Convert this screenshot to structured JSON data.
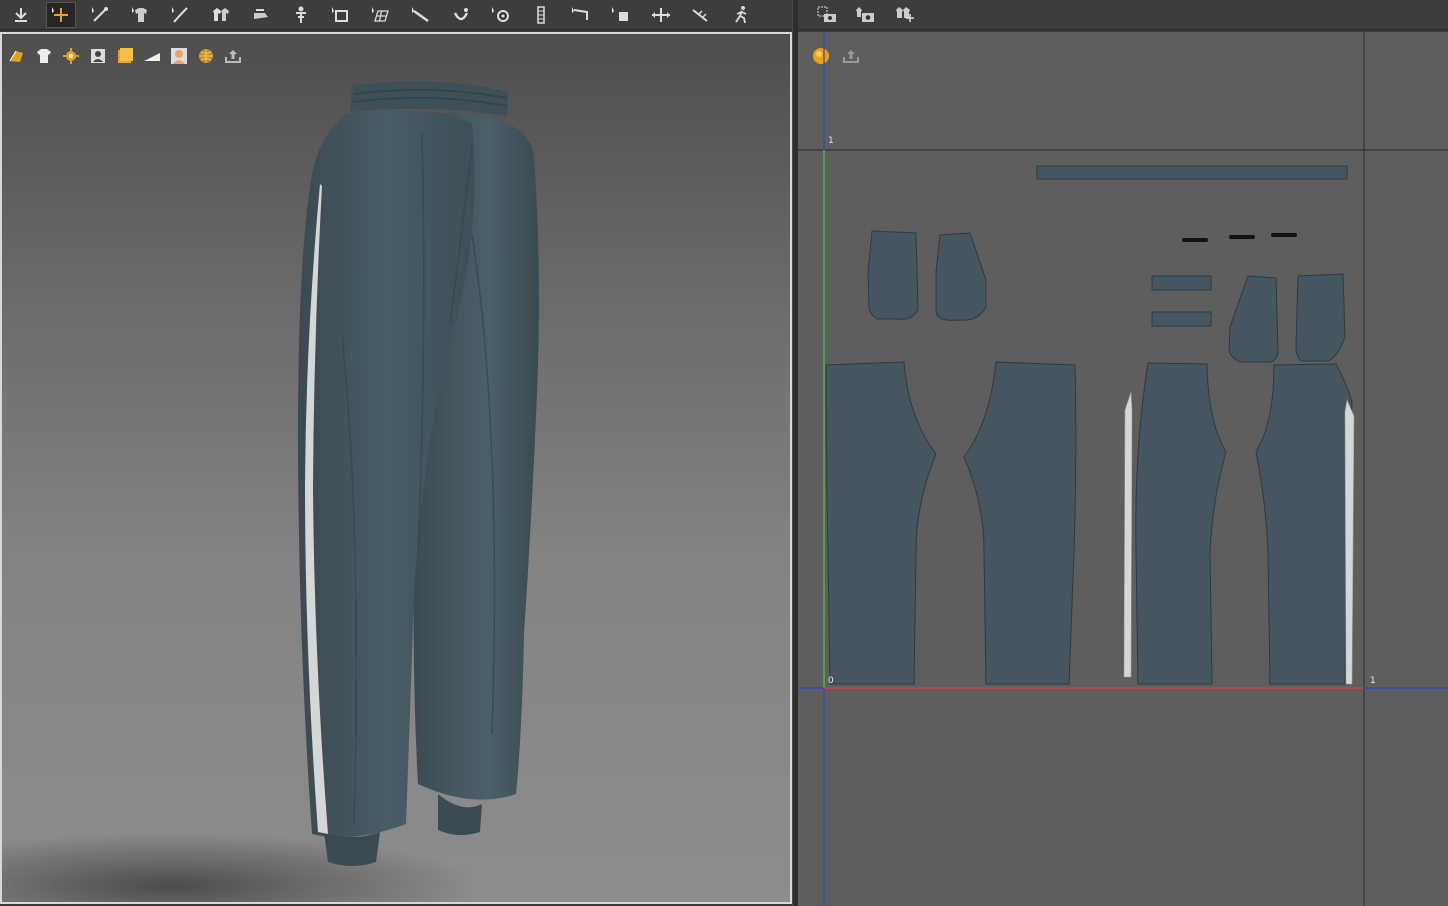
{
  "toolbar_3d": {
    "icons": [
      "simulate-icon",
      "select-move-icon",
      "edit-pattern-icon",
      "fold-arrangement-icon",
      "edit-curvature-icon",
      "arrange-icon",
      "tack-icon",
      "pin-icon",
      "transform-icon",
      "mesh-icon",
      "measure-icon",
      "avatar-pin-icon",
      "fabric-icon",
      "zipper-icon",
      "trim-icon",
      "select-icon",
      "stretch-icon",
      "crease-icon",
      "pose-icon"
    ]
  },
  "toolbar_2d": {
    "icons": [
      "snapshot-icon",
      "snapshot-3d-icon",
      "grid-icon"
    ]
  },
  "viewport_3d": {
    "tools": [
      "show-avatar-icon",
      "show-garment-icon",
      "show-pins-icon",
      "show-body-icon",
      "show-texture-icon",
      "show-wireframe-icon",
      "show-skin-icon",
      "show-globe-icon",
      "export-icon"
    ]
  },
  "viewport_2d": {
    "tools": [
      "sphere-icon",
      "export-icon"
    ],
    "axis_labels": {
      "top_left": "1",
      "origin": "0",
      "right": "1"
    }
  },
  "colors": {
    "fabric": "#465761",
    "fabric_dark": "#3d4c55",
    "stripe": "#d5d6d6",
    "uv_bg": "#5e5e5e",
    "axis_green": "#4cd13c",
    "axis_red": "#c9453d",
    "axis_blue": "#3440c8"
  }
}
